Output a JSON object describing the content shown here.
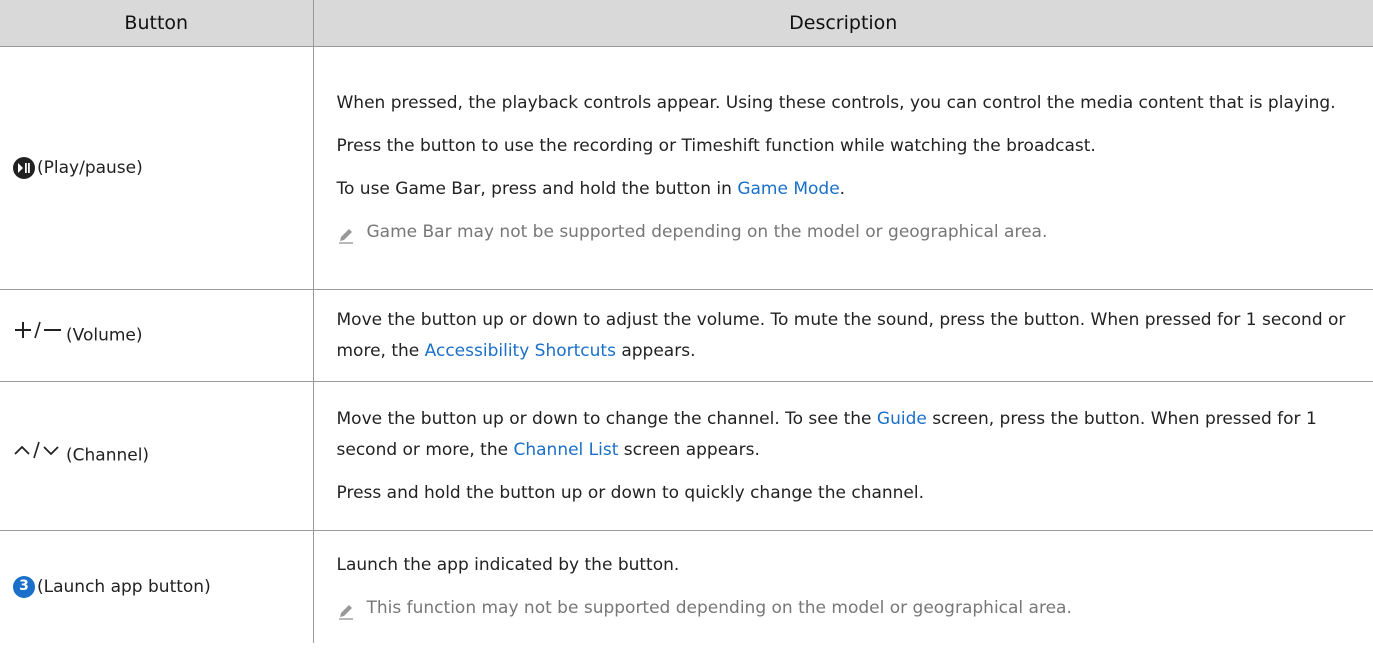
{
  "header": {
    "col_button": "Button",
    "col_description": "Description"
  },
  "rows": [
    {
      "button_label": "(Play/pause)",
      "icon": "play-pause-icon",
      "desc": {
        "p1": "When pressed, the playback controls appear. Using these controls, you can control the media content that is playing.",
        "p2": "Press the button to use the recording or Timeshift function while watching the broadcast.",
        "p3_before": "To use Game Bar, press and hold the button in ",
        "p3_link": "Game Mode",
        "p3_after": ".",
        "note": "Game Bar may not be supported depending on the model or geographical area."
      }
    },
    {
      "button_label": "(Volume)",
      "icon": "plus-minus-icon",
      "desc": {
        "p1_before": "Move the button up or down to adjust the volume. To mute the sound, press the button. When pressed for 1 second or more, the ",
        "p1_link": "Accessibility Shortcuts",
        "p1_after": " appears."
      }
    },
    {
      "button_label": "(Channel)",
      "icon": "chevron-up-down-icon",
      "desc": {
        "p1_a": "Move the button up or down to change the channel. To see the ",
        "p1_link1": "Guide",
        "p1_b": " screen, press the button. When pressed for 1 second or more, the ",
        "p1_link2": "Channel List",
        "p1_c": " screen appears.",
        "p2": "Press and hold the button up or down to quickly change the channel."
      }
    },
    {
      "button_label": "(Launch app button)",
      "icon": "launch-app-3-icon",
      "icon_text": "3",
      "desc": {
        "p1": "Launch the app indicated by the button.",
        "note": "This function may not be supported depending on the model or geographical area."
      }
    }
  ],
  "colors": {
    "link": "#1a6fc9",
    "header_bg": "#d9d9d9",
    "note_text": "#777777",
    "launch_badge": "#1a6fc9"
  }
}
